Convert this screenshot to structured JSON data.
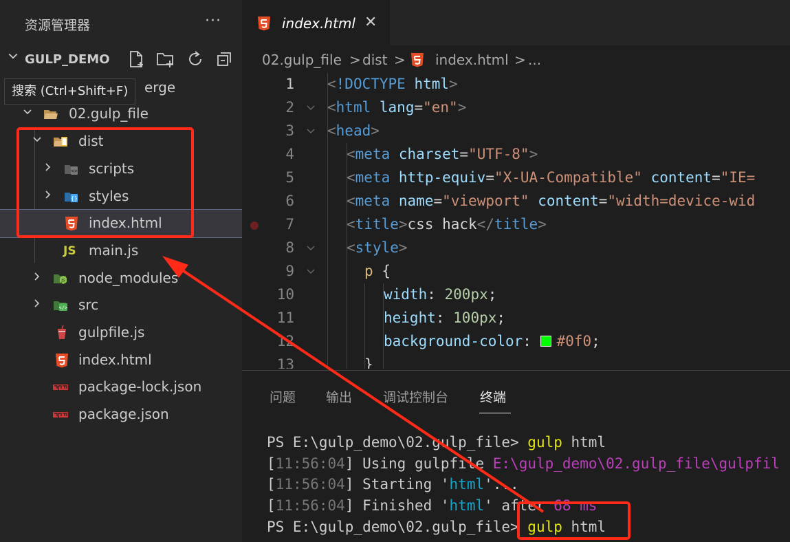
{
  "sidebar": {
    "title": "资源管理器",
    "more_label": "···",
    "section_name": "GULP_DEMO",
    "tooltip": "搜索 (Ctrl+Shift+F)",
    "hidden_row_tail": "erge",
    "tree": [
      {
        "label": "02.gulp_file",
        "icon": "folder-open-icon"
      },
      {
        "label": "dist",
        "icon": "dist-folder-icon"
      },
      {
        "label": "scripts",
        "icon": "scripts-folder-icon"
      },
      {
        "label": "styles",
        "icon": "styles-folder-icon"
      },
      {
        "label": "index.html",
        "icon": "html5-icon"
      },
      {
        "label": "main.js",
        "icon": "js-icon",
        "icon_text": "JS"
      },
      {
        "label": "node_modules",
        "icon": "node-folder-icon"
      },
      {
        "label": "src",
        "icon": "src-folder-icon"
      },
      {
        "label": "gulpfile.js",
        "icon": "gulp-icon"
      },
      {
        "label": "index.html",
        "icon": "html5-icon"
      },
      {
        "label": "package-lock.json",
        "icon": "npm-icon"
      },
      {
        "label": "package.json",
        "icon": "npm-icon"
      }
    ]
  },
  "editor": {
    "tab_label": "index.html",
    "tab_close": "✕",
    "breadcrumb": {
      "part1": "02.gulp_file",
      "part2": "dist",
      "part3": "index.html",
      "sep": ">",
      "ellipsis": "..."
    },
    "lines": [
      {
        "n": "1"
      },
      {
        "n": "2"
      },
      {
        "n": "3"
      },
      {
        "n": "4"
      },
      {
        "n": "5"
      },
      {
        "n": "6"
      },
      {
        "n": "7"
      },
      {
        "n": "8"
      },
      {
        "n": "9"
      },
      {
        "n": "10"
      },
      {
        "n": "11"
      },
      {
        "n": "12"
      },
      {
        "n": "13"
      }
    ],
    "code": {
      "l1_doctype": "!DOCTYPE",
      "l1_html": "html",
      "l2_tag": "html",
      "l2_attr": "lang",
      "l2_val": "\"en\"",
      "l3_tag": "head",
      "l4_tag": "meta",
      "l4_attr": "charset",
      "l4_val": "\"UTF-8\"",
      "l5_tag": "meta",
      "l5_attr": "http-equiv",
      "l5_val": "\"X-UA-Compatible\"",
      "l5_attr2": "content",
      "l5_val2": "\"IE=",
      "l6_tag": "meta",
      "l6_attr": "name",
      "l6_val": "\"viewport\"",
      "l6_attr2": "content",
      "l6_val2": "\"width=device-wid",
      "l7_tag": "title",
      "l7_text": "css hack",
      "l8_tag": "style",
      "l9_sel": "p",
      "l9_brace": "{",
      "l10_prop": "width",
      "l10_val": "200px",
      "l11_prop": "height",
      "l11_val": "100px",
      "l12_prop": "background-color",
      "l12_val": "#0f0",
      "l12_swatch_color": "#00ff00",
      "l13_brace": "}"
    }
  },
  "panel": {
    "tabs": [
      "问题",
      "输出",
      "调试控制台",
      "终端"
    ],
    "active_tab": "终端",
    "terminal": {
      "prompt1": "PS E:\\gulp_demo\\02.gulp_file> ",
      "cmd1": "gulp",
      "arg1": " html",
      "t1": "11:56:04",
      "msg1": " Using gulpfile ",
      "path1": "E:\\gulp_demo\\02.gulp_file\\gulpfil",
      "t2": "11:56:04",
      "msg2a": " Starting '",
      "task2": "html",
      "msg2b": "'...",
      "t3": "11:56:04",
      "msg3a": " Finished '",
      "task3": "html",
      "msg3b": "' after ",
      "dur3": "68 ms",
      "prompt2": "PS E:\\gulp_demo\\02.gulp_file> ",
      "cmd2": "gulp",
      "arg2": " html"
    }
  },
  "colors": {
    "annotation_red": "#ff2a17",
    "html5_orange": "#e44d26",
    "js_yellow": "#cbcb41",
    "npm_red": "#cb3837"
  }
}
